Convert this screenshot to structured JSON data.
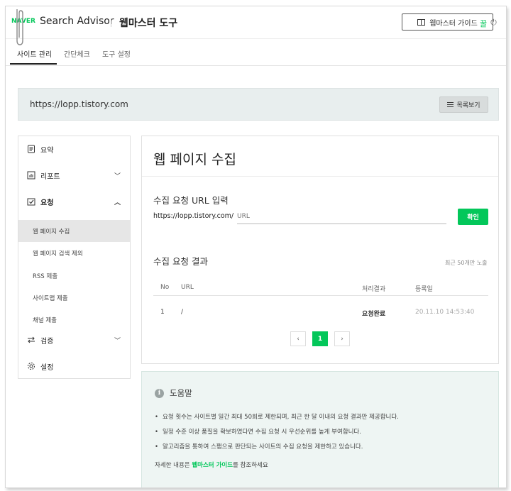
{
  "header": {
    "logo": "NAVER",
    "brand": "Search Advisor",
    "tool_title": "웹마스터 도구",
    "guide_button": "웹마스터 가이드",
    "right_glyph": "꿀"
  },
  "tabs": [
    {
      "label": "사이트 관리",
      "active": true
    },
    {
      "label": "간단체크",
      "active": false
    },
    {
      "label": "도구 설정",
      "active": false
    }
  ],
  "site": {
    "url": "https://lopp.tistory.com",
    "list_button": "목록보기"
  },
  "sidebar": {
    "items": [
      {
        "label": "요약",
        "icon": "document-icon"
      },
      {
        "label": "리포트",
        "icon": "bar-chart-icon"
      },
      {
        "label": "요청",
        "icon": "checkbox-icon"
      },
      {
        "label": "검증",
        "icon": "swap-icon"
      },
      {
        "label": "설정",
        "icon": "gear-icon"
      }
    ],
    "sub_items": [
      "웹 페이지 수집",
      "웹 페이지 검색 제외",
      "RSS 제출",
      "사이트맵 제출",
      "채널 제출"
    ]
  },
  "main": {
    "title": "웹 페이지 수집",
    "input_section_title": "수집 요청 URL 입력",
    "url_prefix": "https://lopp.tistory.com/",
    "url_placeholder": "URL",
    "confirm_button": "확인",
    "results_title": "수집 요청 결과",
    "recent_note": "최근 50개만 노출",
    "table": {
      "headers": [
        "No",
        "URL",
        "처리결과",
        "등록일"
      ],
      "rows": [
        {
          "no": "1",
          "url": "/",
          "status": "요청완료",
          "date": "20.11.10 14:53:40"
        }
      ]
    },
    "pagination": {
      "prev": "‹",
      "current": "1",
      "next": "›"
    }
  },
  "help": {
    "title": "도움말",
    "bullets": [
      "요청 횟수는 사이트별 일간 최대 50회로 제한되며, 최근 한 달 이내의 요청 결과만 제공합니다.",
      "일정 수준 이상 품질을 확보하였다면 수집 요청 시 우선순위를 높게 부여합니다.",
      "알고리즘을 통하여 스팸으로 판단되는 사이트의 수집 요청을 제한하고 있습니다."
    ],
    "footer_prefix": "자세한 내용은 ",
    "footer_link": "웹마스터 가이드",
    "footer_suffix": "를 참조하세요"
  },
  "colors": {
    "brand_green": "#03c75a",
    "url_bar_bg": "#e8eeee",
    "help_bg": "#eef5f3"
  }
}
